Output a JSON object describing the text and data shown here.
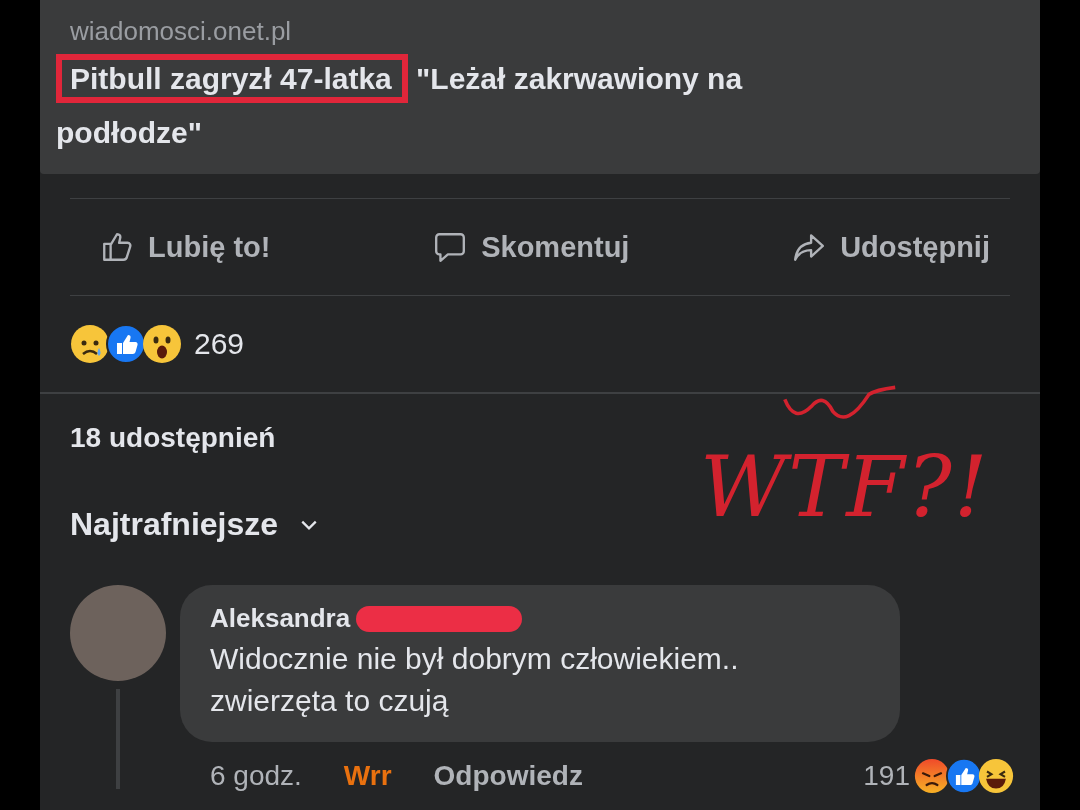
{
  "link_preview": {
    "domain": "wiadomosci.onet.pl",
    "headline_highlighted": "Pitbull zagryzł 47-latka",
    "headline_rest": "\"Leżał zakrwawiony na podłodze\""
  },
  "actions": [
    {
      "kind": "like",
      "label": "Lubię to!"
    },
    {
      "kind": "comment",
      "label": "Skomentuj"
    },
    {
      "kind": "share",
      "label": "Udostępnij"
    }
  ],
  "reactions": {
    "icons": [
      {
        "kind": "sad"
      },
      {
        "kind": "like"
      },
      {
        "kind": "wow"
      }
    ],
    "count": "269"
  },
  "shares": "18 udostępnień",
  "sort": {
    "label": "Najtrafniejsze"
  },
  "annotation": {
    "text": "WTF?!"
  },
  "comment": {
    "author": "Aleksandra",
    "redacted": true,
    "text": "Widocznie nie był dobrym człowiekiem.. zwierzęta to czują",
    "time": "6 godz.",
    "my_reaction": {
      "label": "Wrr",
      "kind": "angry"
    },
    "reply": "Odpowiedz",
    "reaction_count": "191",
    "reaction_icons": [
      {
        "kind": "angry"
      },
      {
        "kind": "like"
      },
      {
        "kind": "haha"
      }
    ]
  }
}
